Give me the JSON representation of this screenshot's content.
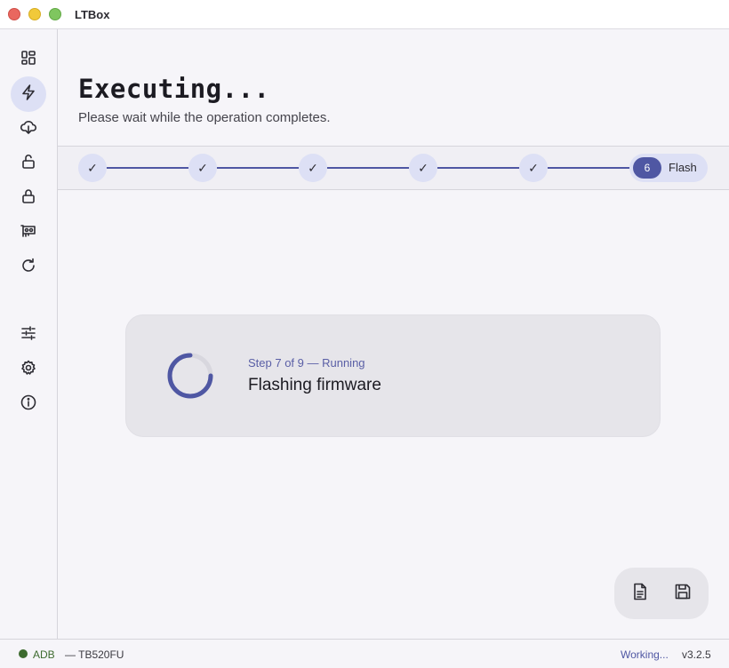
{
  "app": {
    "title": "LTBox"
  },
  "sidebar": {
    "items": [
      {
        "icon": "dashboard-icon"
      },
      {
        "icon": "flash-icon",
        "active": true
      },
      {
        "icon": "download-icon"
      },
      {
        "icon": "unlock-icon"
      },
      {
        "icon": "lock-icon"
      },
      {
        "icon": "device-icon"
      },
      {
        "icon": "refresh-icon"
      },
      {
        "icon": "tune-icon"
      },
      {
        "icon": "settings-icon"
      },
      {
        "icon": "info-icon"
      }
    ]
  },
  "header": {
    "title": "Executing...",
    "subtitle": "Please wait while the operation completes."
  },
  "stepper": {
    "completed_mark": "✓",
    "completed_count": 5,
    "active": {
      "number": "6",
      "label": "Flash"
    }
  },
  "progress": {
    "meta": "Step 7 of 9 — Running",
    "task": "Flashing firmware"
  },
  "actions": {
    "log_icon": "document-icon",
    "save_icon": "save-icon"
  },
  "status": {
    "connection": "ADB",
    "device": "— TB520FU",
    "state": "Working...",
    "version": "v3.2.5"
  },
  "colors": {
    "accent": "#4f57a3",
    "accent_light": "#dde0f5",
    "connection_ok": "#3d6b2f"
  }
}
